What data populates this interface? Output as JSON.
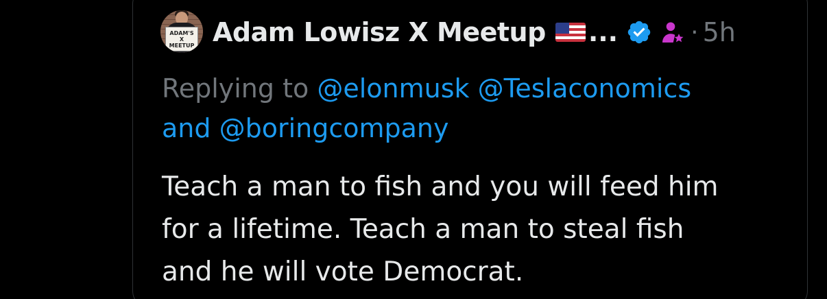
{
  "post": {
    "author": {
      "display_name": "Adam Lowisz X Meetup",
      "name_truncation": "...",
      "avatar_sign": [
        "ADAM'S",
        "X",
        "MEETUP"
      ],
      "flag_emoji": "us-flag",
      "verified_icon": "verified-badge-icon",
      "affiliate_icon": "person-star-icon"
    },
    "separator": "·",
    "timestamp": "5h",
    "reply_context": {
      "prefix": "Replying to",
      "mentions": [
        "@elonmusk",
        "@Teslaconomics",
        "@boringcompany"
      ],
      "conjunction": "and"
    },
    "text_lines": [
      "Teach a man to fish and you will feed him",
      "for a lifetime. Teach a man to steal fish",
      "and he will vote Democrat."
    ]
  },
  "colors": {
    "background": "#000000",
    "text_primary": "#e7e9ea",
    "text_secondary": "#71767b",
    "link": "#1d9bf0",
    "verified": "#1d9bf0",
    "affiliate": "#c936cc",
    "border": "#2f3336"
  }
}
